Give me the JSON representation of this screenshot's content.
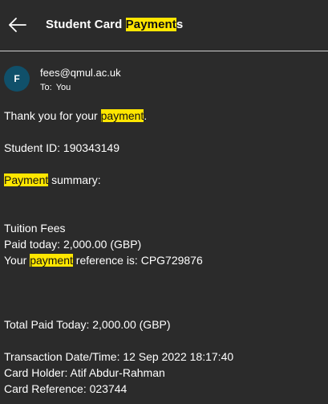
{
  "header": {
    "title_prefix": "Student Card ",
    "title_highlight": "Payment",
    "title_suffix": "s"
  },
  "sender": {
    "avatar_initial": "F",
    "from": "fees@qmul.ac.uk",
    "to_label": "To:",
    "to_value": "You"
  },
  "body": {
    "line1_prefix": "Thank you for your ",
    "line1_highlight": "payment",
    "line1_suffix": ".",
    "student_id": "Student ID: 190343149",
    "summary_highlight": "Payment",
    "summary_suffix": " summary:",
    "tuition_fees": "Tuition Fees",
    "paid_today": "Paid today: 2,000.00 (GBP)",
    "ref_prefix": "Your ",
    "ref_highlight": "payment",
    "ref_suffix": " reference is: CPG729876",
    "total_paid": "Total Paid Today: 2,000.00 (GBP)",
    "transaction": "Transaction Date/Time: 12 Sep 2022 18:17:40",
    "card_holder": "Card Holder: Atif Abdur-Rahman",
    "card_reference": "Card Reference: 023744"
  },
  "colors": {
    "background": "#2b2b2b",
    "highlight": "#ffe600",
    "avatar": "#10506a"
  },
  "icons": {
    "back": "back-arrow-icon"
  }
}
